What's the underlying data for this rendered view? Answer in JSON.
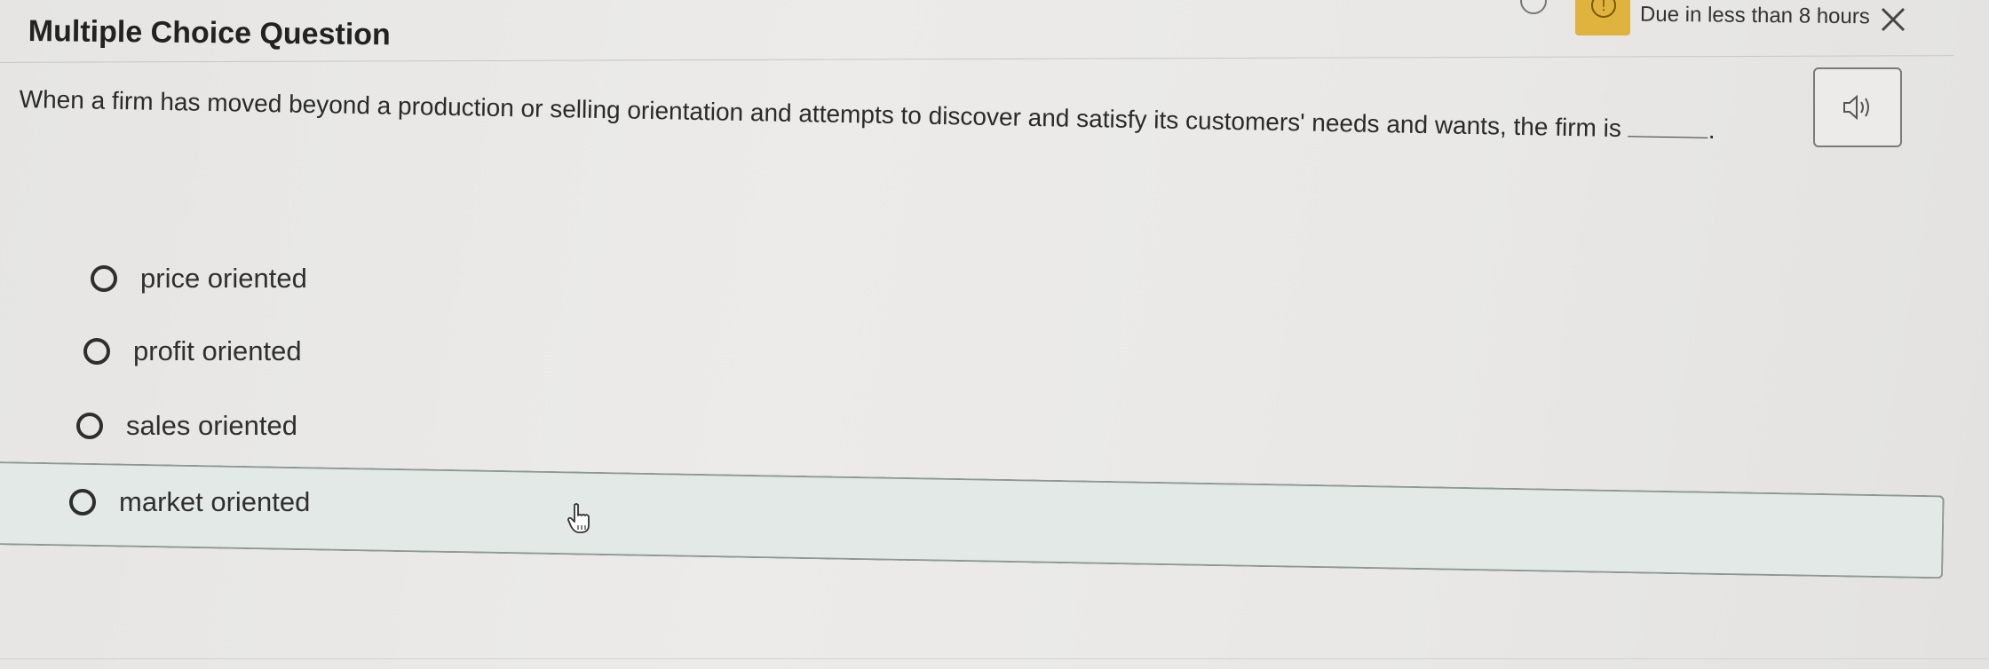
{
  "header": {
    "title": "Multiple Choice Question",
    "due_text": "Due in less than 8 hours",
    "alert_symbol": "!"
  },
  "question": {
    "text": "When a firm has moved beyond a production or selling orientation and attempts to discover and satisfy its customers' needs and wants, the firm is",
    "blank_suffix": "."
  },
  "options": [
    {
      "label": "price oriented",
      "selected": false
    },
    {
      "label": "profit oriented",
      "selected": false
    },
    {
      "label": "sales oriented",
      "selected": false
    },
    {
      "label": "market oriented",
      "selected": false,
      "hovered": true
    }
  ],
  "icons": {
    "audio": "speaker-icon",
    "close": "close-icon",
    "alert": "alert-icon",
    "cursor": "hand-pointer-icon"
  },
  "colors": {
    "alert_bg": "#e0b23e",
    "hover_band": "#e3e9e7"
  }
}
